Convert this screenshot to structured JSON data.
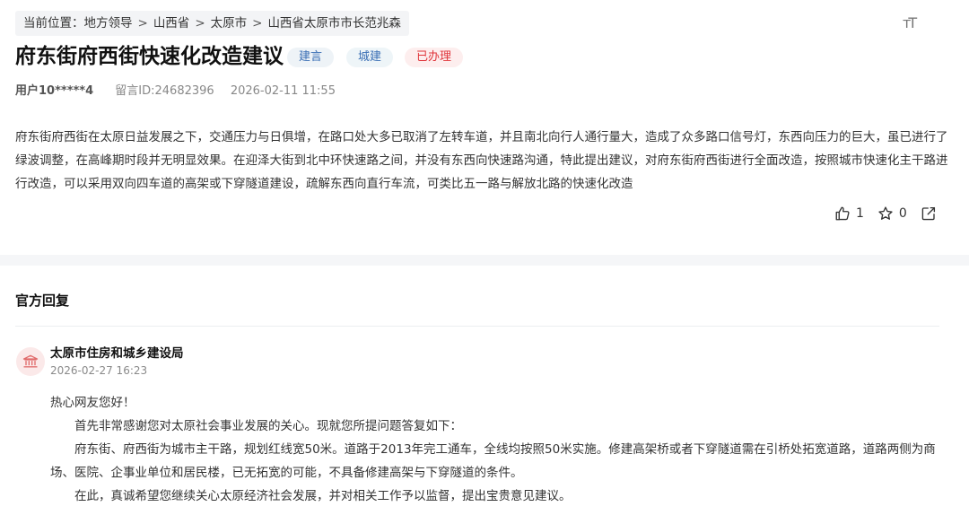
{
  "breadcrumb": {
    "prefix": "当前位置：",
    "items": [
      "地方领导",
      "山西省",
      "太原市",
      "山西省太原市市长范兆森"
    ],
    "separator": ">"
  },
  "font_size_icon": "ᴛT",
  "post": {
    "title": "府东街府西街快速化改造建议",
    "tags": [
      {
        "label": "建言",
        "color": "#3a6fb5"
      },
      {
        "label": "城建",
        "color": "#3a6fb5"
      },
      {
        "label": "已办理",
        "color": "#e0353b"
      }
    ],
    "user": "用户10*****4",
    "message_id": "留言ID:24682396",
    "datetime": "2026-02-11 11:55",
    "body": "府东街府西街在太原日益发展之下，交通压力与日俱增，在路口处大多已取消了左转车道，并且南北向行人通行量大，造成了众多路口信号灯，东西向压力的巨大，虽已进行了绿波调整，在高峰期时段并无明显效果。在迎泽大街到北中环快速路之间，并没有东西向快速路沟通，特此提出建议，对府东街府西街进行全面改造，按照城市快速化主干路进行改造，可以采用双向四车道的高架或下穿隧道建设，疏解东西向直行车流，可类比五一路与解放北路的快速化改造",
    "likes": "1",
    "favorites": "0"
  },
  "official_reply": {
    "heading": "官方回复",
    "org_name": "太原市住房和城乡建设局",
    "datetime": "2026-02-27 16:23",
    "greeting": "热心网友您好！",
    "paragraphs": [
      "首先非常感谢您对太原社会事业发展的关心。现就您所提问题答复如下：",
      "府东街、府西街为城市主干路，规划红线宽50米。道路于2013年完工通车，全线均按照50米实施。修建高架桥或者下穿隧道需在引桥处拓宽道路，道路两侧为商场、医院、企事业单位和居民楼，已无拓宽的可能，不具备修建高架与下穿隧道的条件。",
      "在此，真诚希望您继续关心太原经济社会发展，并对相关工作予以监督，提出宝贵意见建议。"
    ]
  },
  "colors": {
    "accent_blue": "#3a6fb5",
    "accent_red": "#e0353b",
    "background": "#f5f6f8"
  }
}
